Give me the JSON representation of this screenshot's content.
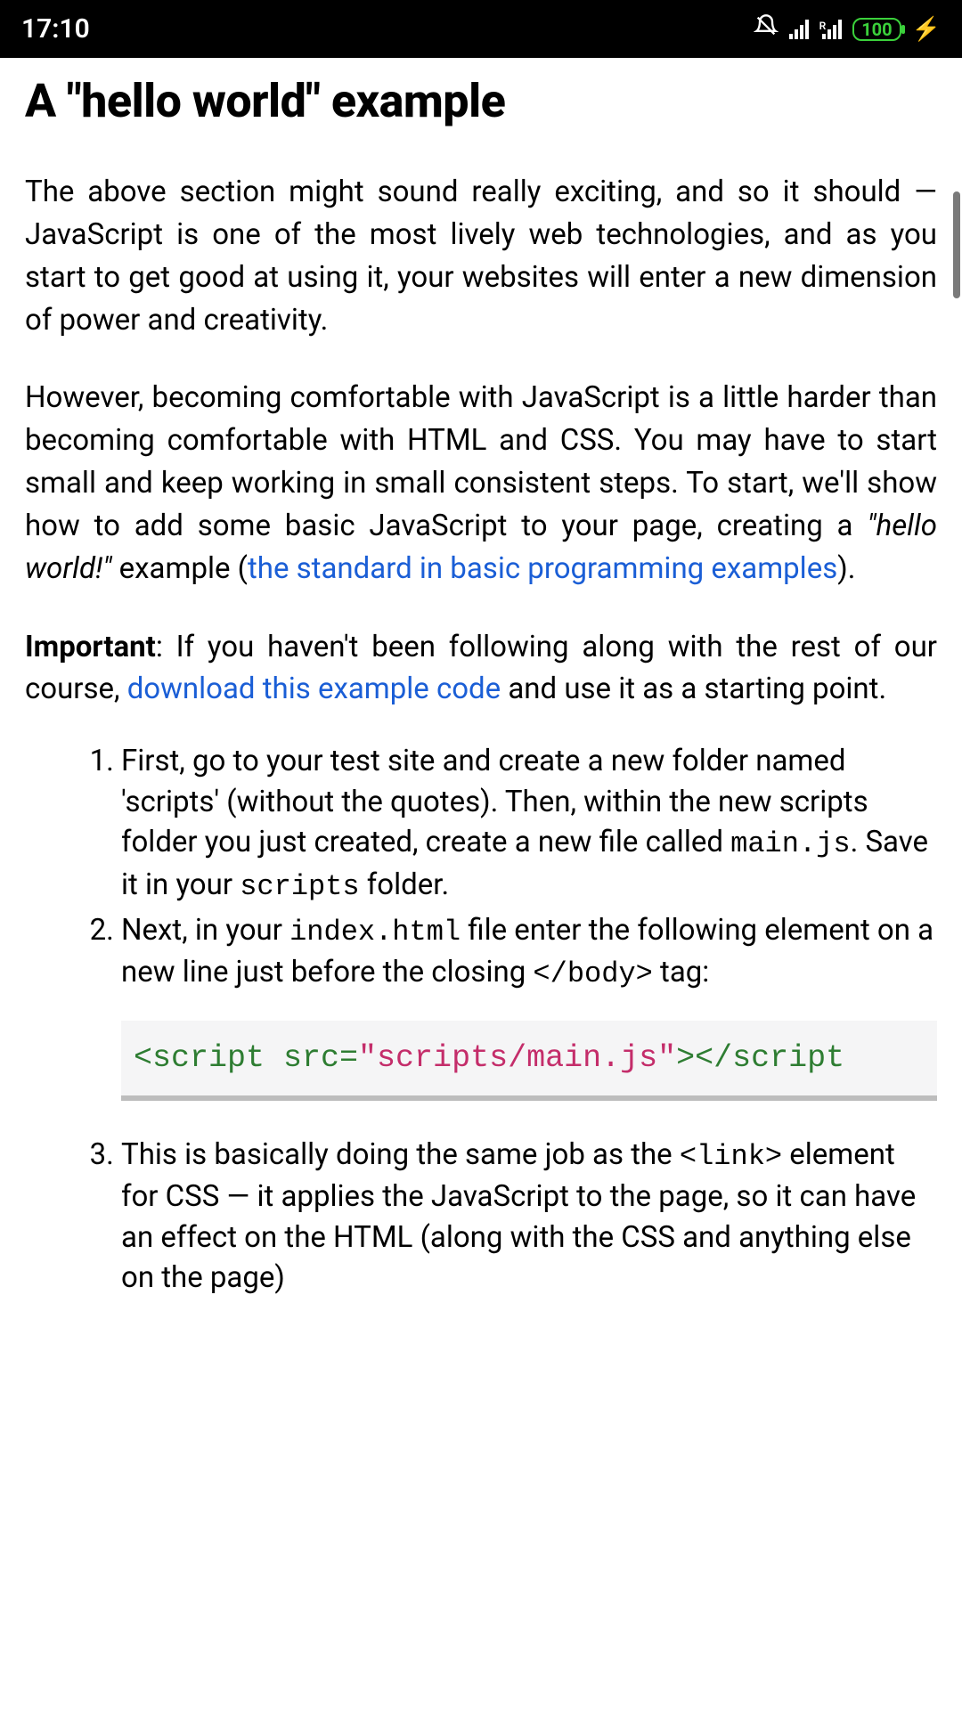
{
  "statusbar": {
    "time": "17:10",
    "battery": "100"
  },
  "article": {
    "heading": "A \"hello world\" example",
    "p1": "The above section might sound really exciting, and so it should — JavaScript is one of the most lively web technologies, and as you start to get good at using it, your websites will enter a new dimension of power and creativity.",
    "p2_a": "However, becoming comfortable with JavaScript is a little harder than becoming comfortable with HTML and CSS. You may have to start small and keep working in small consistent steps. To start, we'll show how to add some basic JavaScript to your page, creating a ",
    "p2_em": "\"hello world!\"",
    "p2_b": " example (",
    "p2_link": "the standard in basic programming examples",
    "p2_c": ").",
    "p3_strong": "Important",
    "p3_a": ": If you haven't been following along with the rest of our course, ",
    "p3_link": "download this example code",
    "p3_b": " and use it as a starting point.",
    "li1_a": "First, go to your test site and create a new folder named 'scripts' (without the quotes). Then, within the new scripts folder you just created, create a new file called ",
    "li1_code1": "main.js",
    "li1_b": ". Save it in your ",
    "li1_code2": "scripts",
    "li1_c": " folder.",
    "li2_a": "Next, in your ",
    "li2_code1": "index.html",
    "li2_b": " file enter the following element on a new line just before the closing ",
    "li2_code2": "</body>",
    "li2_c": " tag:",
    "code_tag_open": "<script ",
    "code_attr_name": "src=",
    "code_attr_val": "\"scripts/main.js\"",
    "code_tag_mid": ">",
    "code_tag_close": "</script",
    "li3_a": "This is basically doing the same job as the ",
    "li3_code1": "<link>",
    "li3_b": " element for CSS — it applies the JavaScript to the page, so it can have an effect on the HTML (along with the CSS  and anything else on the page)"
  }
}
